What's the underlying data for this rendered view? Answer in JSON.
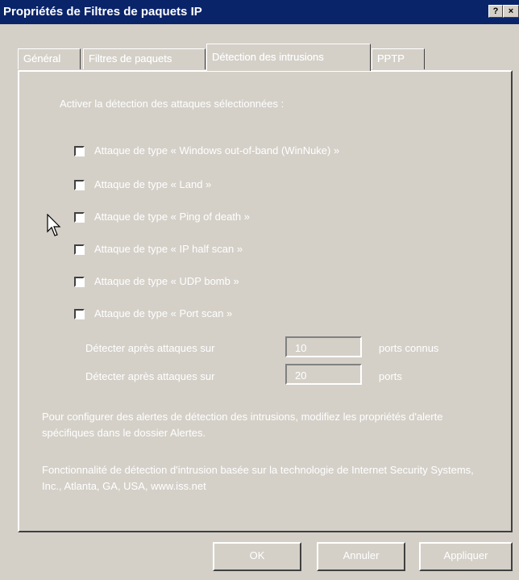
{
  "window": {
    "title": "Propriétés de Filtres de paquets IP",
    "help_label": "?",
    "close_label": "×"
  },
  "tabs": [
    {
      "label": "Général",
      "active": false
    },
    {
      "label": "Filtres de paquets",
      "active": false
    },
    {
      "label": "Détection des intrusions",
      "active": true
    },
    {
      "label": "PPTP",
      "active": false
    }
  ],
  "intrusion": {
    "heading": "Activer la détection des attaques sélectionnées :",
    "attacks": [
      {
        "label": "Attaque de type « Windows out-of-band (WinNuke) »",
        "checked": false
      },
      {
        "label": "Attaque de type « Land »",
        "checked": false
      },
      {
        "label": "Attaque de type « Ping of death »",
        "checked": false
      },
      {
        "label": "Attaque de type « IP half scan »",
        "checked": false
      },
      {
        "label": "Attaque de type « UDP bomb »",
        "checked": false
      },
      {
        "label": "Attaque de type « Port scan »",
        "checked": false
      }
    ],
    "well_known_label": "Détecter après attaques sur",
    "well_known_value": "10",
    "well_known_suffix": "ports connus",
    "all_ports_label": "Détecter après attaques sur",
    "all_ports_value": "20",
    "all_ports_suffix": "ports",
    "note": "Pour configurer des alertes de détection des intrusions, modifiez les propriétés d'alerte spécifiques dans le dossier Alertes.",
    "credit": "Fonctionnalité de détection d'intrusion basée sur la technologie de Internet Security Systems, Inc., Atlanta, GA, USA, www.iss.net"
  },
  "buttons": {
    "ok": "OK",
    "cancel": "Annuler",
    "apply": "Appliquer"
  }
}
